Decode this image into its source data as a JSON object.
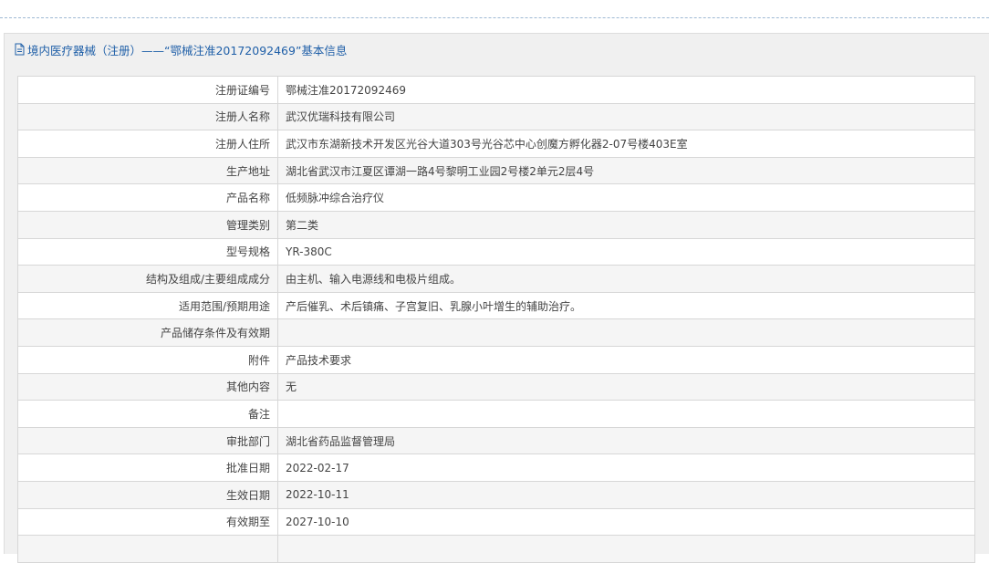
{
  "header": {
    "title": "境内医疗器械（注册）——“鄂械注准20172092469”基本信息",
    "icon": "document-icon"
  },
  "rows": [
    {
      "label": "注册证编号",
      "value": "鄂械注准20172092469"
    },
    {
      "label": "注册人名称",
      "value": "武汉优瑞科技有限公司"
    },
    {
      "label": "注册人住所",
      "value": "武汉市东湖新技术开发区光谷大道303号光谷芯中心创魔方孵化器2-07号楼403E室"
    },
    {
      "label": "生产地址",
      "value": "湖北省武汉市江夏区谭湖一路4号黎明工业园2号楼2单元2层4号"
    },
    {
      "label": "产品名称",
      "value": "低频脉冲综合治疗仪"
    },
    {
      "label": "管理类别",
      "value": "第二类"
    },
    {
      "label": "型号规格",
      "value": "YR-380C"
    },
    {
      "label": "结构及组成/主要组成成分",
      "value": "由主机、输入电源线和电极片组成。"
    },
    {
      "label": "适用范围/预期用途",
      "value": "产后催乳、术后镇痛、子宫复旧、乳腺小叶增生的辅助治疗。"
    },
    {
      "label": "产品储存条件及有效期",
      "value": ""
    },
    {
      "label": "附件",
      "value": "产品技术要求"
    },
    {
      "label": "其他内容",
      "value": "无"
    },
    {
      "label": "备注",
      "value": ""
    },
    {
      "label": "审批部门",
      "value": "湖北省药品监督管理局"
    },
    {
      "label": "批准日期",
      "value": "2022-02-17"
    },
    {
      "label": "生效日期",
      "value": "2022-10-11"
    },
    {
      "label": "有效期至",
      "value": "2027-10-10"
    },
    {
      "label": "",
      "value": ""
    }
  ],
  "colors": {
    "header_text": "#1f5fa8",
    "panel_bg": "#f0f0f0",
    "row_alt_bg": "#f5f5f5",
    "border": "#d7d7d7"
  }
}
